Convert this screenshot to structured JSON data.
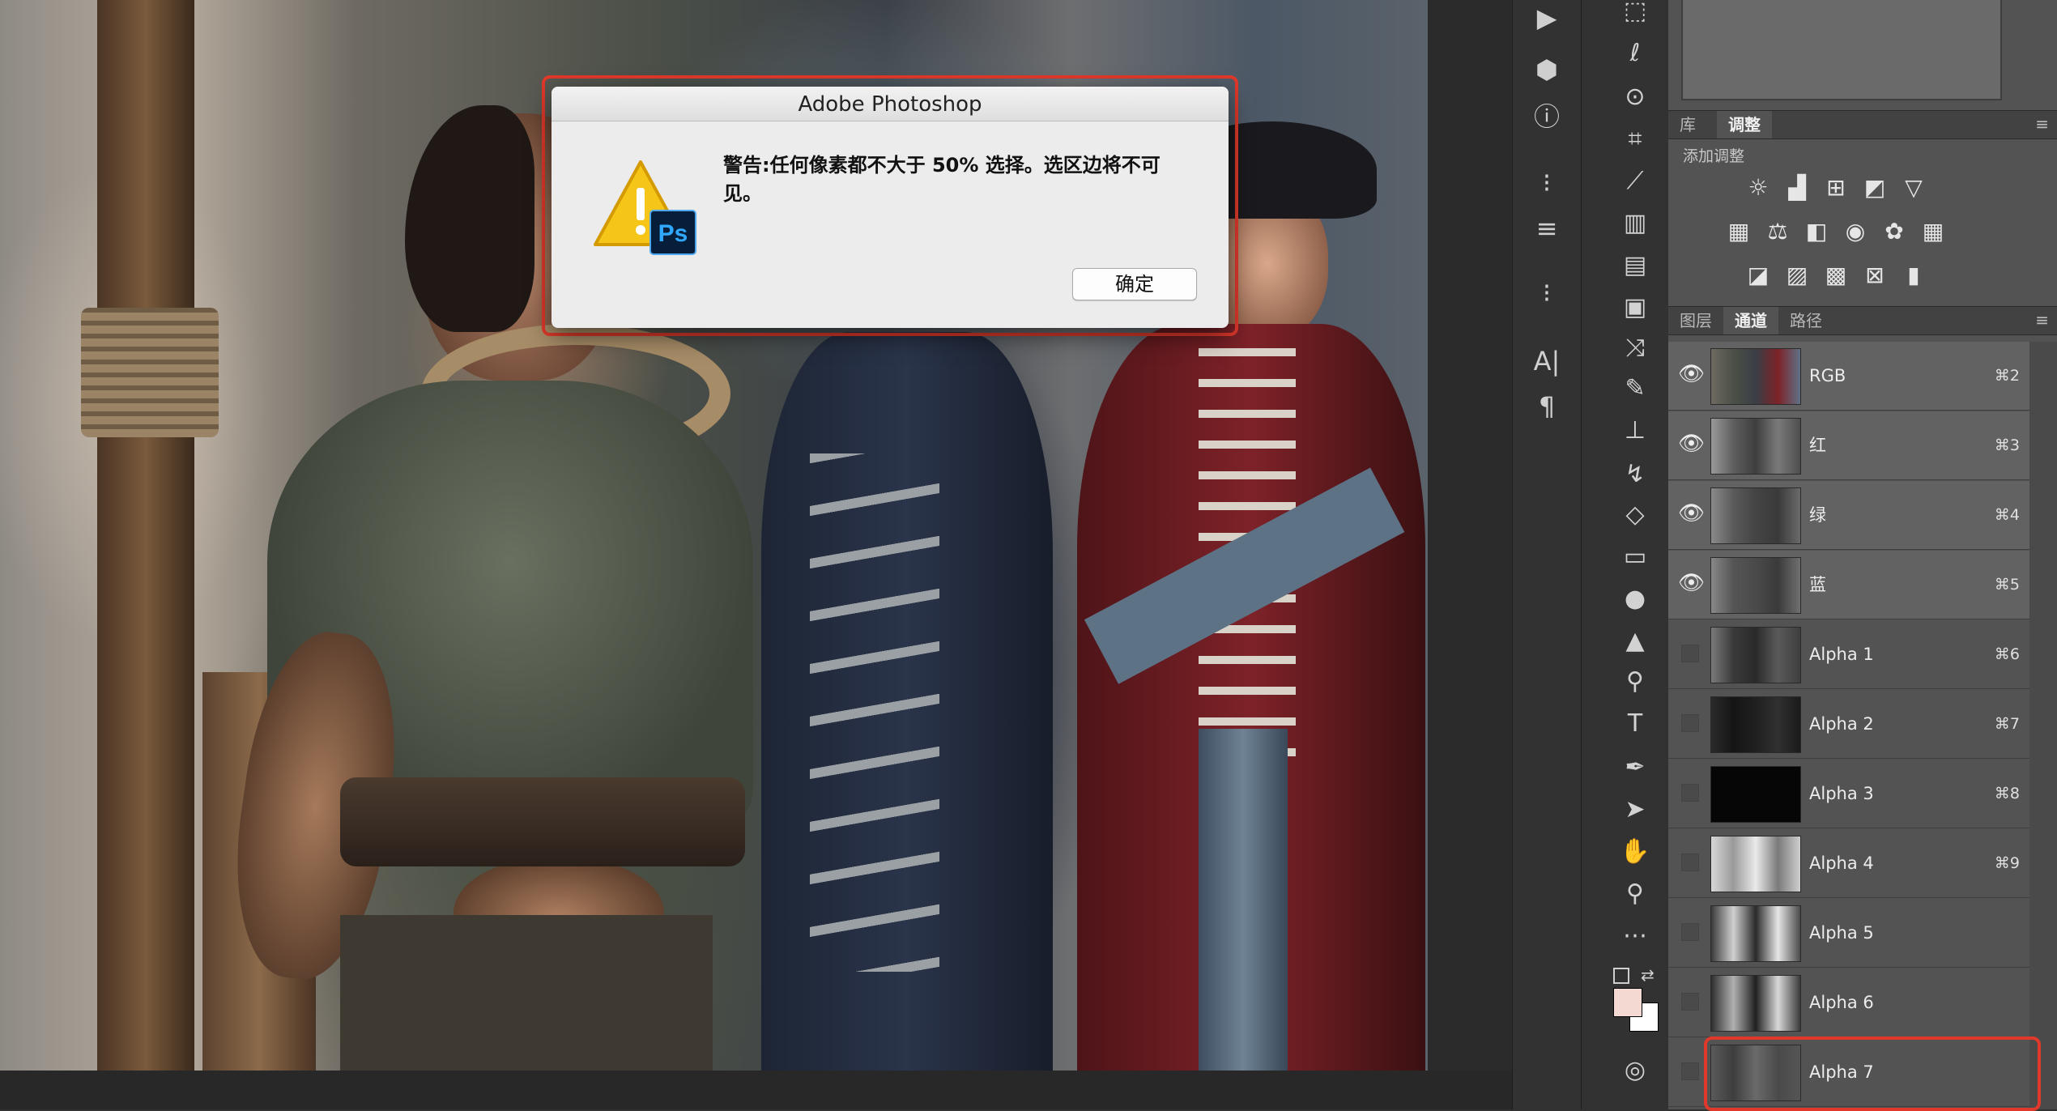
{
  "dialog": {
    "title": "Adobe Photoshop",
    "message": "警告:任何像素都不大于 50% 选择。选区边将不可见。",
    "ok_label": "确定",
    "icon_badge": "Ps"
  },
  "tools": [
    "play-icon",
    "rect-marquee-icon",
    "3d-cube-icon",
    "info-icon",
    "lasso-icon",
    "quick-select-icon",
    "crop-icon",
    "eyedropper-icon",
    "healing-brush-icon",
    "brush-icon",
    "clone-stamp-icon",
    "history-brush-icon",
    "eraser-icon",
    "gradient-icon",
    "blur-icon",
    "sharpen-icon",
    "dodge-icon",
    "type-icon",
    "pen-icon",
    "path-select-icon",
    "hand-icon",
    "zoom-icon",
    "more-icon"
  ],
  "palette_icons": [
    "play-icon",
    "3d-cube-icon",
    "info-icon",
    "brush-settings-icon",
    "adjust-sliders-icon",
    "clone-source-icon",
    "character-icon",
    "paragraph-icon"
  ],
  "palette_glyphs": {
    "character": "A|",
    "paragraph": "¶"
  },
  "adjustments_panel": {
    "tabs": [
      "库",
      "调整"
    ],
    "active_tab": "调整",
    "subtitle": "添加调整",
    "icons": [
      "brightness-icon",
      "levels-icon",
      "curves-icon",
      "exposure-icon",
      "vibrance-icon",
      "hue-saturation-icon",
      "color-balance-icon",
      "black-white-icon",
      "photo-filter-icon",
      "channel-mixer-icon",
      "color-lookup-icon",
      "invert-icon",
      "posterize-icon",
      "threshold-icon",
      "selective-color-icon",
      "gradient-map-icon"
    ]
  },
  "channels_panel": {
    "tabs": [
      "图层",
      "通道",
      "路径"
    ],
    "active_tab": "通道",
    "channels": [
      {
        "name": "RGB",
        "shortcut": "⌘2",
        "visible": true
      },
      {
        "name": "红",
        "shortcut": "⌘3",
        "visible": true
      },
      {
        "name": "绿",
        "shortcut": "⌘4",
        "visible": true
      },
      {
        "name": "蓝",
        "shortcut": "⌘5",
        "visible": true
      },
      {
        "name": "Alpha 1",
        "shortcut": "⌘6",
        "visible": false
      },
      {
        "name": "Alpha 2",
        "shortcut": "⌘7",
        "visible": false
      },
      {
        "name": "Alpha 3",
        "shortcut": "⌘8",
        "visible": false
      },
      {
        "name": "Alpha 4",
        "shortcut": "⌘9",
        "visible": false
      },
      {
        "name": "Alpha 5",
        "shortcut": "",
        "visible": false
      },
      {
        "name": "Alpha 6",
        "shortcut": "",
        "visible": false
      },
      {
        "name": "Alpha 7",
        "shortcut": "",
        "visible": false
      }
    ]
  },
  "colors": {
    "foreground": "#f4d9d2",
    "background": "#ffffff",
    "highlight": "#e0392b"
  }
}
